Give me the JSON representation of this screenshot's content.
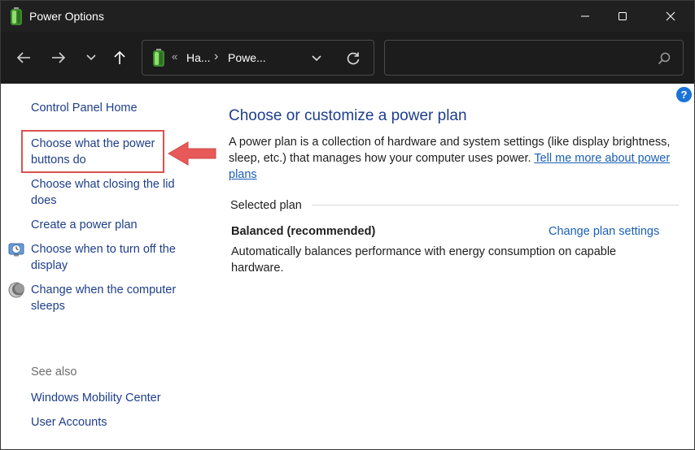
{
  "window": {
    "title": "Power Options"
  },
  "icons": {
    "app": "battery-icon",
    "back": "arrow-left-icon",
    "forward": "arrow-right-icon",
    "recent": "chevron-down-icon",
    "up": "arrow-up-icon",
    "refresh": "refresh-icon",
    "search": "search-icon",
    "help": "help-icon",
    "display": "clock-display-icon",
    "sleep": "moon-icon",
    "minimize": "minimize-icon",
    "maximize": "maximize-icon",
    "close": "close-icon"
  },
  "address": {
    "overflow_chevron": "«",
    "crumbs": [
      "Ha...",
      "Powe..."
    ],
    "separator": "›"
  },
  "search": {
    "placeholder": "",
    "value": ""
  },
  "help": {
    "label": "?"
  },
  "sidebar": {
    "links": [
      "Control Panel Home",
      "Choose what the power buttons do",
      "Choose what closing the lid does",
      "Create a power plan",
      "Choose when to turn off the display",
      "Change when the computer sleeps"
    ],
    "see_also_label": "See also",
    "see_also": [
      "Windows Mobility Center",
      "User Accounts"
    ]
  },
  "main": {
    "heading": "Choose or customize a power plan",
    "description": "A power plan is a collection of hardware and system settings (like display brightness, sleep, etc.) that manages how your computer uses power. ",
    "description_link": "Tell me more about power plans",
    "selected_plan_label": "Selected plan",
    "plan": {
      "name": "Balanced (recommended)",
      "change_link": "Change plan settings",
      "description": "Automatically balances performance with energy consumption on capable hardware."
    }
  },
  "colors": {
    "titlebar": "#202020",
    "navbar": "#1c1c1c",
    "link": "#1e3e8a",
    "accent_link": "#1a5fb4",
    "highlight": "#d9534f"
  }
}
